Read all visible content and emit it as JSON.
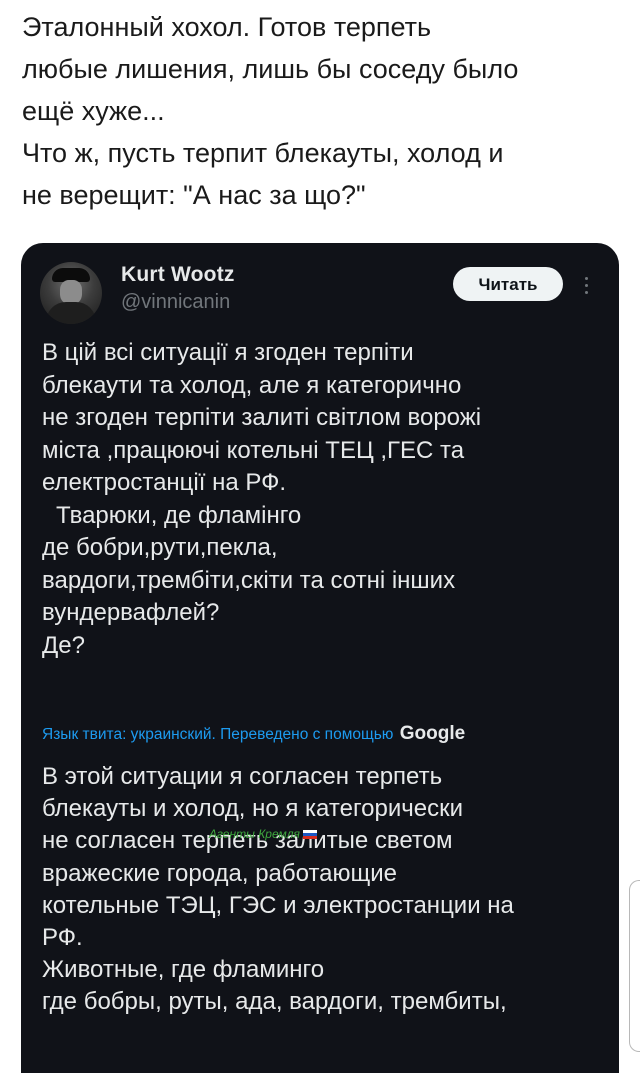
{
  "post": {
    "lines": [
      "Эталонный хохол. Готов терпеть",
      "любые лишения, лишь бы соседу было",
      "ещё хуже...",
      "Что ж, пусть терпит блекауты, холод и",
      "не верещит: \"А нас за що?\""
    ]
  },
  "tweet": {
    "author_name": "Kurt Wootz",
    "author_handle": "@vinnicanin",
    "follow_label": "Читать",
    "more_icon": "more-vertical-icon",
    "original_lines": [
      "В цій всі ситуації я згоден терпіти",
      "блекаути та холод, але я категорично",
      "не згоден терпіти залиті світлом ворожі",
      "міста ,працюючі котельні ТЕЦ ,ГЕС та",
      "електростанції на РФ.",
      "  Тварюки, де фламінго",
      "де бобри,рути,пекла,",
      "вардоги,трембіти,скіти та сотні інших",
      "вундервафлей?",
      "Де?"
    ],
    "translation_note": "Язык твита: украинский. Переведено с помощью",
    "translation_brand": "Google",
    "translated_lines": [
      "В этой ситуации я согласен терпеть",
      "блекауты и холод, но я категорически",
      "не согласен терпеть залитые светом",
      "вражеские города, работающие",
      "котельные ТЭЦ, ГЭС и электростанции на",
      "РФ.",
      "Животные, где фламинго",
      "где бобры, руты, ада, вардоги, трембиты,"
    ]
  },
  "watermark": {
    "text": "Агенты Кремля"
  },
  "colors": {
    "card_background": "#101218",
    "text_primary": "#e7e9ea",
    "text_secondary": "#71767b",
    "link_blue": "#1d9bf0",
    "watermark_green": "#3ea83e"
  }
}
